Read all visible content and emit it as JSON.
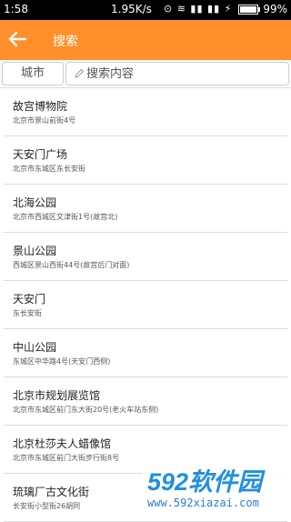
{
  "status_bar": {
    "time": "1:58",
    "speed": "1.95K/s",
    "indicators": "⊙ ≋ ▮▮ ▮▮ ⚡",
    "battery_percent": "99%",
    "battery_level": 0.99
  },
  "app_bar": {
    "title": "搜索",
    "back_icon": "arrow-left-icon",
    "color": "#ff8f2a"
  },
  "search": {
    "city_label": "城市",
    "placeholder": "搜索内容",
    "value": ""
  },
  "results": [
    {
      "name": "故宫博物院",
      "address": "北京市景山前街4号"
    },
    {
      "name": "天安门广场",
      "address": "北京市东城区东长安街"
    },
    {
      "name": "北海公园",
      "address": "北京市西城区文津街1号(故宫北)"
    },
    {
      "name": "景山公园",
      "address": "西城区景山西街44号(故宫后门对面)"
    },
    {
      "name": "天安门",
      "address": "东长安街"
    },
    {
      "name": "中山公园",
      "address": "东城区中华路4号(天安门西侧)"
    },
    {
      "name": "北京市规划展览馆",
      "address": "北京市东城区前门东大街20号(老火车站东侧)"
    },
    {
      "name": "北京杜莎夫人蜡像馆",
      "address": "北京市东城区前门大街步行街8号"
    },
    {
      "name": "琉璃厂古文化街",
      "address": "长安街小型街26胡同"
    }
  ],
  "watermark": {
    "logo_text": "592软件园",
    "url": "www.592xiazai.com"
  }
}
